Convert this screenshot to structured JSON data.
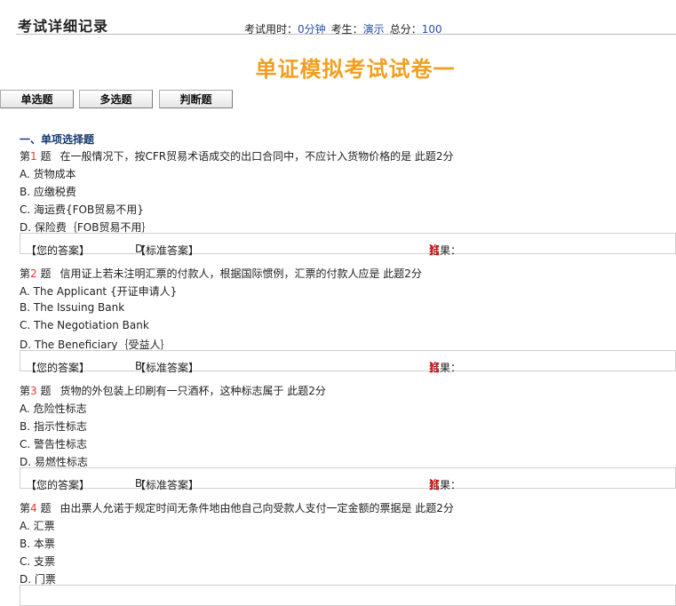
{
  "header": {
    "record_title": "考试详细记录",
    "duration_label": "考试用时：",
    "duration_value": "0分钟",
    "examinee_label": "考生：",
    "examinee_value": "演示",
    "score_label": "总分：",
    "score_value": "100"
  },
  "paper_title": "单证模拟考试试卷一",
  "tabs": [
    "单选题",
    "多选题",
    "判断题"
  ],
  "section_heading": "一、单项选择题",
  "answer_labels": {
    "yours": "【您的答案】",
    "standard": "【标准答案】",
    "result": "结果：",
    "result_open": "【",
    "result_mark": "X",
    "result_close": "】"
  },
  "questions": [
    {
      "prefix": "第",
      "number": "1",
      "suffix": " 题",
      "text": "在一般情况下，按CFR贸易术语成交的出口合同中，不应计入货物价格的是 此题2分",
      "options": [
        "A. 货物成本",
        "B. 应缴税费",
        "C. 海运费{FOB贸易不用}",
        "D. 保险费｛FOB贸易不用｝"
      ],
      "your_answer": "",
      "standard_answer": "D"
    },
    {
      "prefix": "第",
      "number": "2",
      "suffix": " 题",
      "text": "信用证上若未注明汇票的付款人，根据国际惯例，汇票的付款人应是 此题2分",
      "options": [
        "A. The Applicant {开证申请人}",
        "B. The Issuing Bank",
        "C. The Negotiation Bank",
        "D. The Beneficiary｛受益人｝"
      ],
      "your_answer": "",
      "standard_answer": "B"
    },
    {
      "prefix": "第",
      "number": "3",
      "suffix": " 题",
      "text": "货物的外包装上印刷有一只酒杯，这种标志属于 此题2分",
      "options": [
        "A. 危险性标志",
        "B. 指示性标志",
        "C. 警告性标志",
        "D. 易燃性标志"
      ],
      "your_answer": "",
      "standard_answer": "B"
    },
    {
      "prefix": "第",
      "number": "4",
      "suffix": " 题",
      "text": "由出票人允诺于规定时间无条件地由他自己向受款人支付一定金额的票据是 此题2分",
      "options": [
        "A. 汇票",
        "B. 本票",
        "C. 支票",
        "D. 门票"
      ],
      "your_answer": "",
      "standard_answer": ""
    }
  ]
}
